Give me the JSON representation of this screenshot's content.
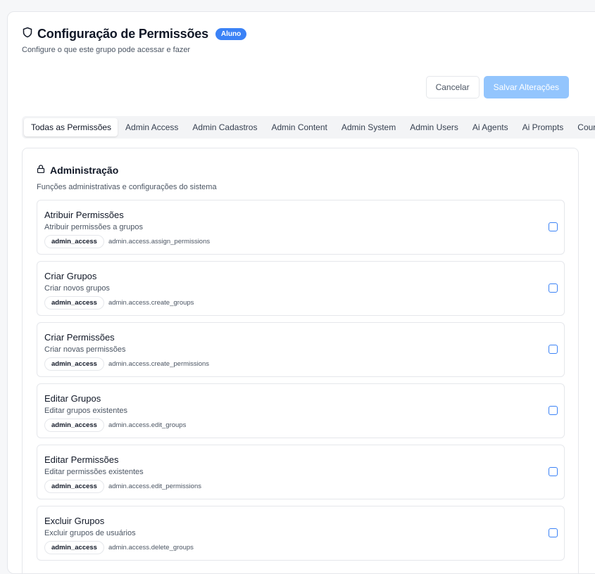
{
  "header": {
    "title": "Configuração de Permissões",
    "badge": "Aluno",
    "subtitle": "Configure o que este grupo pode acessar e fazer"
  },
  "actions": {
    "cancel_label": "Cancelar",
    "save_label": "Salvar Alterações"
  },
  "tabs": [
    {
      "label": "Todas as Permissões",
      "active": true
    },
    {
      "label": "Admin Access"
    },
    {
      "label": "Admin Cadastros"
    },
    {
      "label": "Admin Content"
    },
    {
      "label": "Admin System"
    },
    {
      "label": "Admin Users"
    },
    {
      "label": "Ai Agents"
    },
    {
      "label": "Ai Prompts"
    },
    {
      "label": "Courses"
    }
  ],
  "section": {
    "icon": "lock-icon",
    "title": "Administração",
    "description": "Funções administrativas e configurações do sistema",
    "permissions": [
      {
        "name": "Atribuir Permissões",
        "description": "Atribuir permissões a grupos",
        "category": "admin_access",
        "code": "admin.access.assign_permissions",
        "checked": false
      },
      {
        "name": "Criar Grupos",
        "description": "Criar novos grupos",
        "category": "admin_access",
        "code": "admin.access.create_groups",
        "checked": false
      },
      {
        "name": "Criar Permissões",
        "description": "Criar novas permissões",
        "category": "admin_access",
        "code": "admin.access.create_permissions",
        "checked": false
      },
      {
        "name": "Editar Grupos",
        "description": "Editar grupos existentes",
        "category": "admin_access",
        "code": "admin.access.edit_groups",
        "checked": false
      },
      {
        "name": "Editar Permissões",
        "description": "Editar permissões existentes",
        "category": "admin_access",
        "code": "admin.access.edit_permissions",
        "checked": false
      },
      {
        "name": "Excluir Grupos",
        "description": "Excluir grupos de usuários",
        "category": "admin_access",
        "code": "admin.access.delete_groups",
        "checked": false
      }
    ]
  },
  "colors": {
    "accent": "#3b82f6",
    "save_disabled": "#93c5fd"
  }
}
